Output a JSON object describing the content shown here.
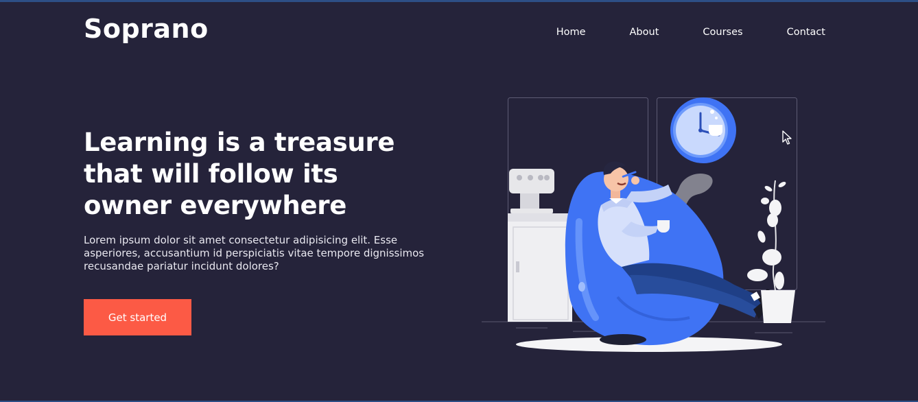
{
  "brand": {
    "name": "Soprano"
  },
  "nav": {
    "items": [
      {
        "label": "Home"
      },
      {
        "label": "About"
      },
      {
        "label": "Courses"
      },
      {
        "label": "Contact"
      }
    ]
  },
  "hero": {
    "headline": "Learning is a treasure that will follow its owner everywhere",
    "description": "Lorem ipsum dolor sit amet consectetur adipisicing elit. Esse asperiores, accusantium id perspiciatis vitae tempore dignissimos recusandae pariatur incidunt dolores?",
    "cta_label": "Get started"
  },
  "colors": {
    "background": "#25233a",
    "accent": "#fc5a45",
    "illustration_blue": "#3f73f4"
  },
  "icons": [
    "mouse-cursor-icon",
    "clock-icon"
  ]
}
